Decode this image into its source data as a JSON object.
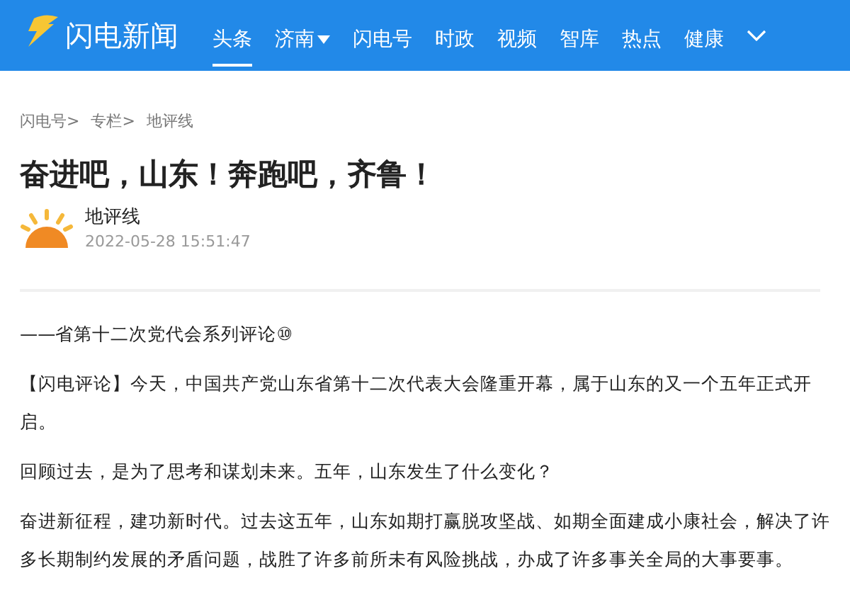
{
  "header": {
    "logo_text": "闪电新闻",
    "nav": [
      {
        "label": "头条",
        "selected": true,
        "dropdown": false
      },
      {
        "label": "济南",
        "selected": false,
        "dropdown": true
      },
      {
        "label": "闪电号",
        "selected": false,
        "dropdown": false
      },
      {
        "label": "时政",
        "selected": false,
        "dropdown": false
      },
      {
        "label": "视频",
        "selected": false,
        "dropdown": false
      },
      {
        "label": "智库",
        "selected": false,
        "dropdown": false
      },
      {
        "label": "热点",
        "selected": false,
        "dropdown": false
      },
      {
        "label": "健康",
        "selected": false,
        "dropdown": false
      }
    ]
  },
  "breadcrumb": [
    "闪电号>",
    "专栏>",
    "地评线"
  ],
  "article": {
    "title": "奋进吧，山东！奔跑吧，齐鲁！",
    "author": "地评线",
    "time": "2022-05-28 15:51:47",
    "paragraphs": [
      "——省第十二次党代会系列评论⑩",
      "【闪电评论】今天，中国共产党山东省第十二次代表大会隆重开幕，属于山东的又一个五年正式开启。",
      "回顾过去，是为了思考和谋划未来。五年，山东发生了什么变化？",
      "奋进新征程，建功新时代。过去这五年，山东如期打赢脱攻坚战、如期全面建成小康社会，解决了许多长期制约发展的矛盾问题，战胜了许多前所未有风险挑战，办成了许多事关全局的大事要事。"
    ]
  }
}
